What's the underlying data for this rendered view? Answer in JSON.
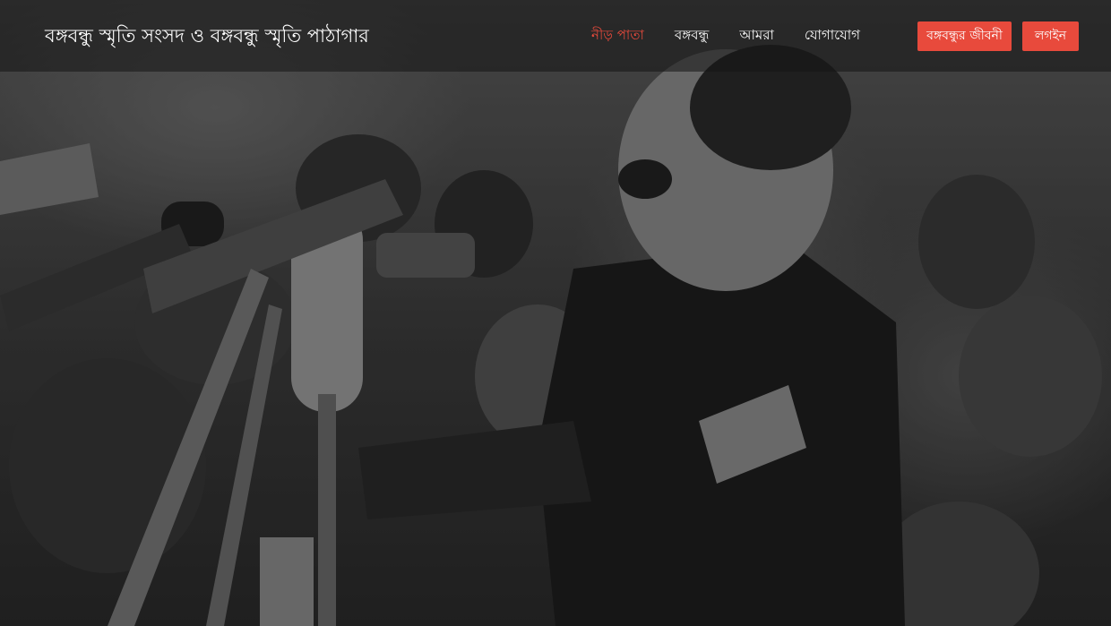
{
  "brand": {
    "title": "বঙ্গবন্ধু স্মৃতি সংসদ ও বঙ্গবন্ধু স্মৃতি পাঠাগার"
  },
  "nav": {
    "items": [
      {
        "label": "নীড় পাতা",
        "active": true
      },
      {
        "label": "বঙ্গবন্ধু",
        "active": false
      },
      {
        "label": "আমরা",
        "active": false
      },
      {
        "label": "যোগাযোগ",
        "active": false
      }
    ]
  },
  "actions": {
    "biography_label": "বঙ্গবন্ধুর জীবনী",
    "login_label": "লগইন"
  },
  "colors": {
    "accent": "#e84a3c",
    "navbar_bg": "#141414"
  },
  "hero": {
    "image": "black-and-white photo of a man speaking at a cluster of microphones before a crowd"
  }
}
